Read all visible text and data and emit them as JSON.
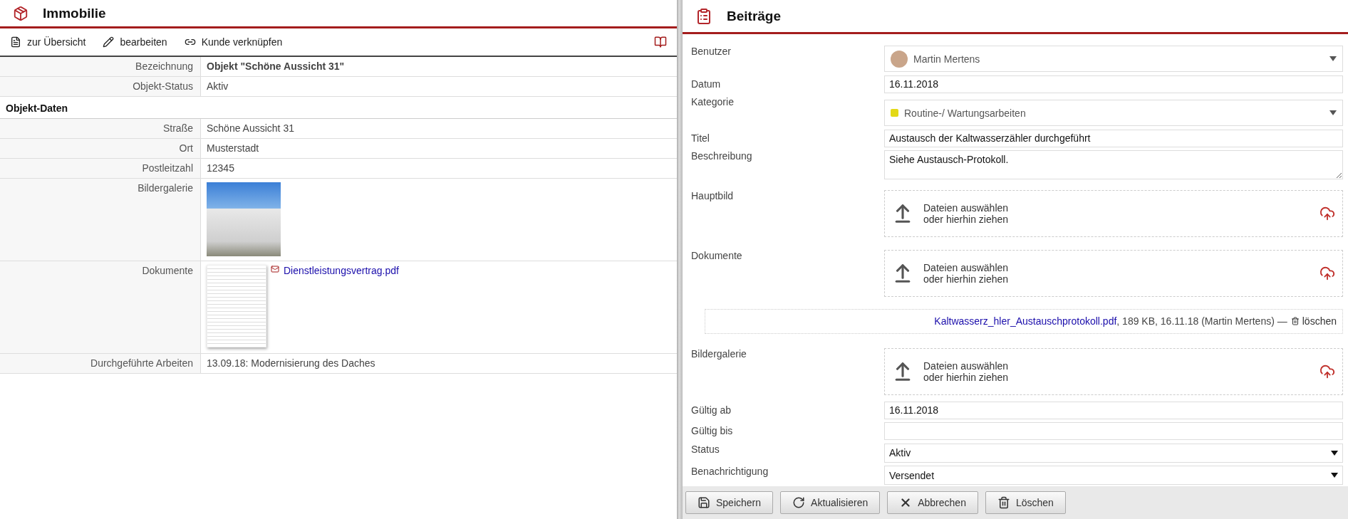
{
  "left": {
    "title": "Immobilie",
    "toolbar": [
      {
        "label": "zur Übersicht",
        "kind": "overview"
      },
      {
        "label": "bearbeiten",
        "kind": "edit"
      },
      {
        "label": "Kunde verknüpfen",
        "kind": "link"
      }
    ],
    "fields": [
      {
        "label": "Bezeichnung",
        "kind": "bold",
        "value": "Objekt \"Schöne Aussicht 31\""
      },
      {
        "label": "Objekt-Status",
        "kind": "text",
        "value": "Aktiv"
      }
    ],
    "section": {
      "title": "Objekt-Daten",
      "fields": [
        {
          "label": "Straße",
          "kind": "text",
          "value": "Schöne Aussicht 31"
        },
        {
          "label": "Ort",
          "kind": "text",
          "value": "Musterstadt"
        },
        {
          "label": "Postleitzahl",
          "kind": "text",
          "value": "12345"
        },
        {
          "label": "Bildergalerie",
          "kind": "image"
        },
        {
          "label": "Dokumente",
          "kind": "document",
          "value": "Dienstleistungsvertrag.pdf"
        },
        {
          "label": "Durchgeführte Arbeiten",
          "kind": "text",
          "value": "13.09.18: Modernisierung des Daches"
        }
      ]
    }
  },
  "right": {
    "title": "Beiträge",
    "fields": [
      {
        "label": "Benutzer",
        "kind": "user-select",
        "value": "Martin Mertens"
      },
      {
        "label": "Datum",
        "kind": "input",
        "value": "16.11.2018"
      },
      {
        "label": "Kategorie",
        "kind": "color-select",
        "value": "Routine-/ Wartungsarbeiten",
        "color": "#e3d916"
      },
      {
        "label": "Titel",
        "kind": "input",
        "value": "Austausch der Kaltwasserzähler durchgeführt"
      },
      {
        "label": "Beschreibung",
        "kind": "textarea",
        "value": "Siehe Austausch-Protokoll."
      },
      {
        "label": "Hauptbild",
        "kind": "dropzone",
        "prompt": [
          "Dateien auswählen",
          "oder hierhin ziehen"
        ]
      },
      {
        "label": "Dokumente",
        "kind": "dropzone",
        "prompt": [
          "Dateien auswählen",
          "oder hierhin ziehen"
        ],
        "files": [
          {
            "name": "Kaltwasserz_hler_Austauschprotokoll.pdf",
            "meta": ", 189 KB, 16.11.18 (Martin Mertens) —",
            "action": "löschen"
          }
        ]
      },
      {
        "label": "Bildergalerie",
        "kind": "dropzone",
        "prompt": [
          "Dateien auswählen",
          "oder hierhin ziehen"
        ]
      },
      {
        "label": "Gültig ab",
        "kind": "input",
        "value": "16.11.2018"
      },
      {
        "label": "Gültig bis",
        "kind": "input"
      },
      {
        "label": "Status",
        "kind": "select",
        "value": "Aktiv"
      },
      {
        "label": "Benachrichtigung",
        "kind": "select",
        "value": "Versendet"
      }
    ],
    "buttons": [
      {
        "label": "Speichern",
        "kind": "save"
      },
      {
        "label": "Aktualisieren",
        "kind": "refresh"
      },
      {
        "label": "Abbrechen",
        "kind": "cancel"
      },
      {
        "label": "Löschen",
        "kind": "delete"
      }
    ]
  }
}
